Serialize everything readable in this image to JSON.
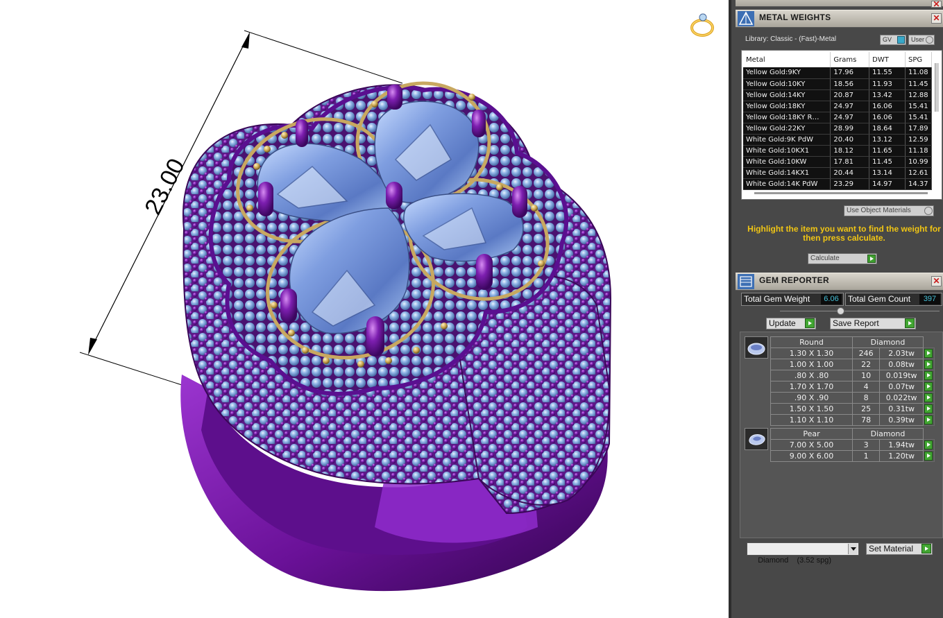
{
  "viewport": {
    "dimension_label": "23.00",
    "ring_icon": "ring-icon"
  },
  "metal_weights": {
    "title": "METAL WEIGHTS",
    "library_label": "Library: Classic - (Fast)-Metal",
    "gv_toggle": "GV",
    "user_toggle": "User",
    "columns": [
      "Metal",
      "Grams",
      "DWT",
      "SPG"
    ],
    "rows": [
      [
        "Yellow Gold:9KY",
        "17.96",
        "11.55",
        "11.08"
      ],
      [
        "Yellow Gold:10KY",
        "18.56",
        "11.93",
        "11.45"
      ],
      [
        "Yellow Gold:14KY",
        "20.87",
        "13.42",
        "12.88"
      ],
      [
        "Yellow Gold:18KY",
        "24.97",
        "16.06",
        "15.41"
      ],
      [
        "Yellow Gold:18KY R…",
        "24.97",
        "16.06",
        "15.41"
      ],
      [
        "Yellow Gold:22KY",
        "28.99",
        "18.64",
        "17.89"
      ],
      [
        "White Gold:9K PdW",
        "20.40",
        "13.12",
        "12.59"
      ],
      [
        "White Gold:10KX1",
        "18.12",
        "11.65",
        "11.18"
      ],
      [
        "White Gold:10KW",
        "17.81",
        "11.45",
        "10.99"
      ],
      [
        "White Gold:14KX1",
        "20.44",
        "13.14",
        "12.61"
      ],
      [
        "White Gold:14K PdW",
        "23.29",
        "14.97",
        "14.37"
      ]
    ],
    "use_object_materials": "Use Object Materials",
    "hint": "Highlight the item you want to find the weight for then press calculate.",
    "calculate": "Calculate"
  },
  "gem_reporter": {
    "title": "GEM REPORTER",
    "total_weight_label": "Total Gem Weight",
    "total_weight_value": "6.06",
    "total_count_label": "Total Gem Count",
    "total_count_value": "397",
    "update": "Update",
    "save_report": "Save Report",
    "groups": [
      {
        "shape": "Round",
        "material": "Diamond",
        "rows": [
          [
            "1.30 X 1.30",
            "246",
            "2.03tw"
          ],
          [
            "1.00 X 1.00",
            "22",
            "0.08tw"
          ],
          [
            ".80 X .80",
            "10",
            "0.019tw"
          ],
          [
            "1.70 X 1.70",
            "4",
            "0.07tw"
          ],
          [
            ".90 X .90",
            "8",
            "0.022tw"
          ],
          [
            "1.50 X 1.50",
            "25",
            "0.31tw"
          ],
          [
            "1.10 X 1.10",
            "78",
            "0.39tw"
          ]
        ]
      },
      {
        "shape": "Pear",
        "material": "Diamond",
        "rows": [
          [
            "7.00 X 5.00",
            "3",
            "1.94tw"
          ],
          [
            "9.00 X 6.00",
            "1",
            "1.20tw"
          ]
        ]
      }
    ],
    "material_select": "Diamond    (3.52 spg)",
    "set_material": "Set Material"
  },
  "colors": {
    "metal_purple": "#7a1aa8",
    "gem_blue": "#7ea6e0",
    "prong_gold": "#c8a860",
    "hint_yellow": "#f0c514",
    "dock_bg": "#484848"
  }
}
